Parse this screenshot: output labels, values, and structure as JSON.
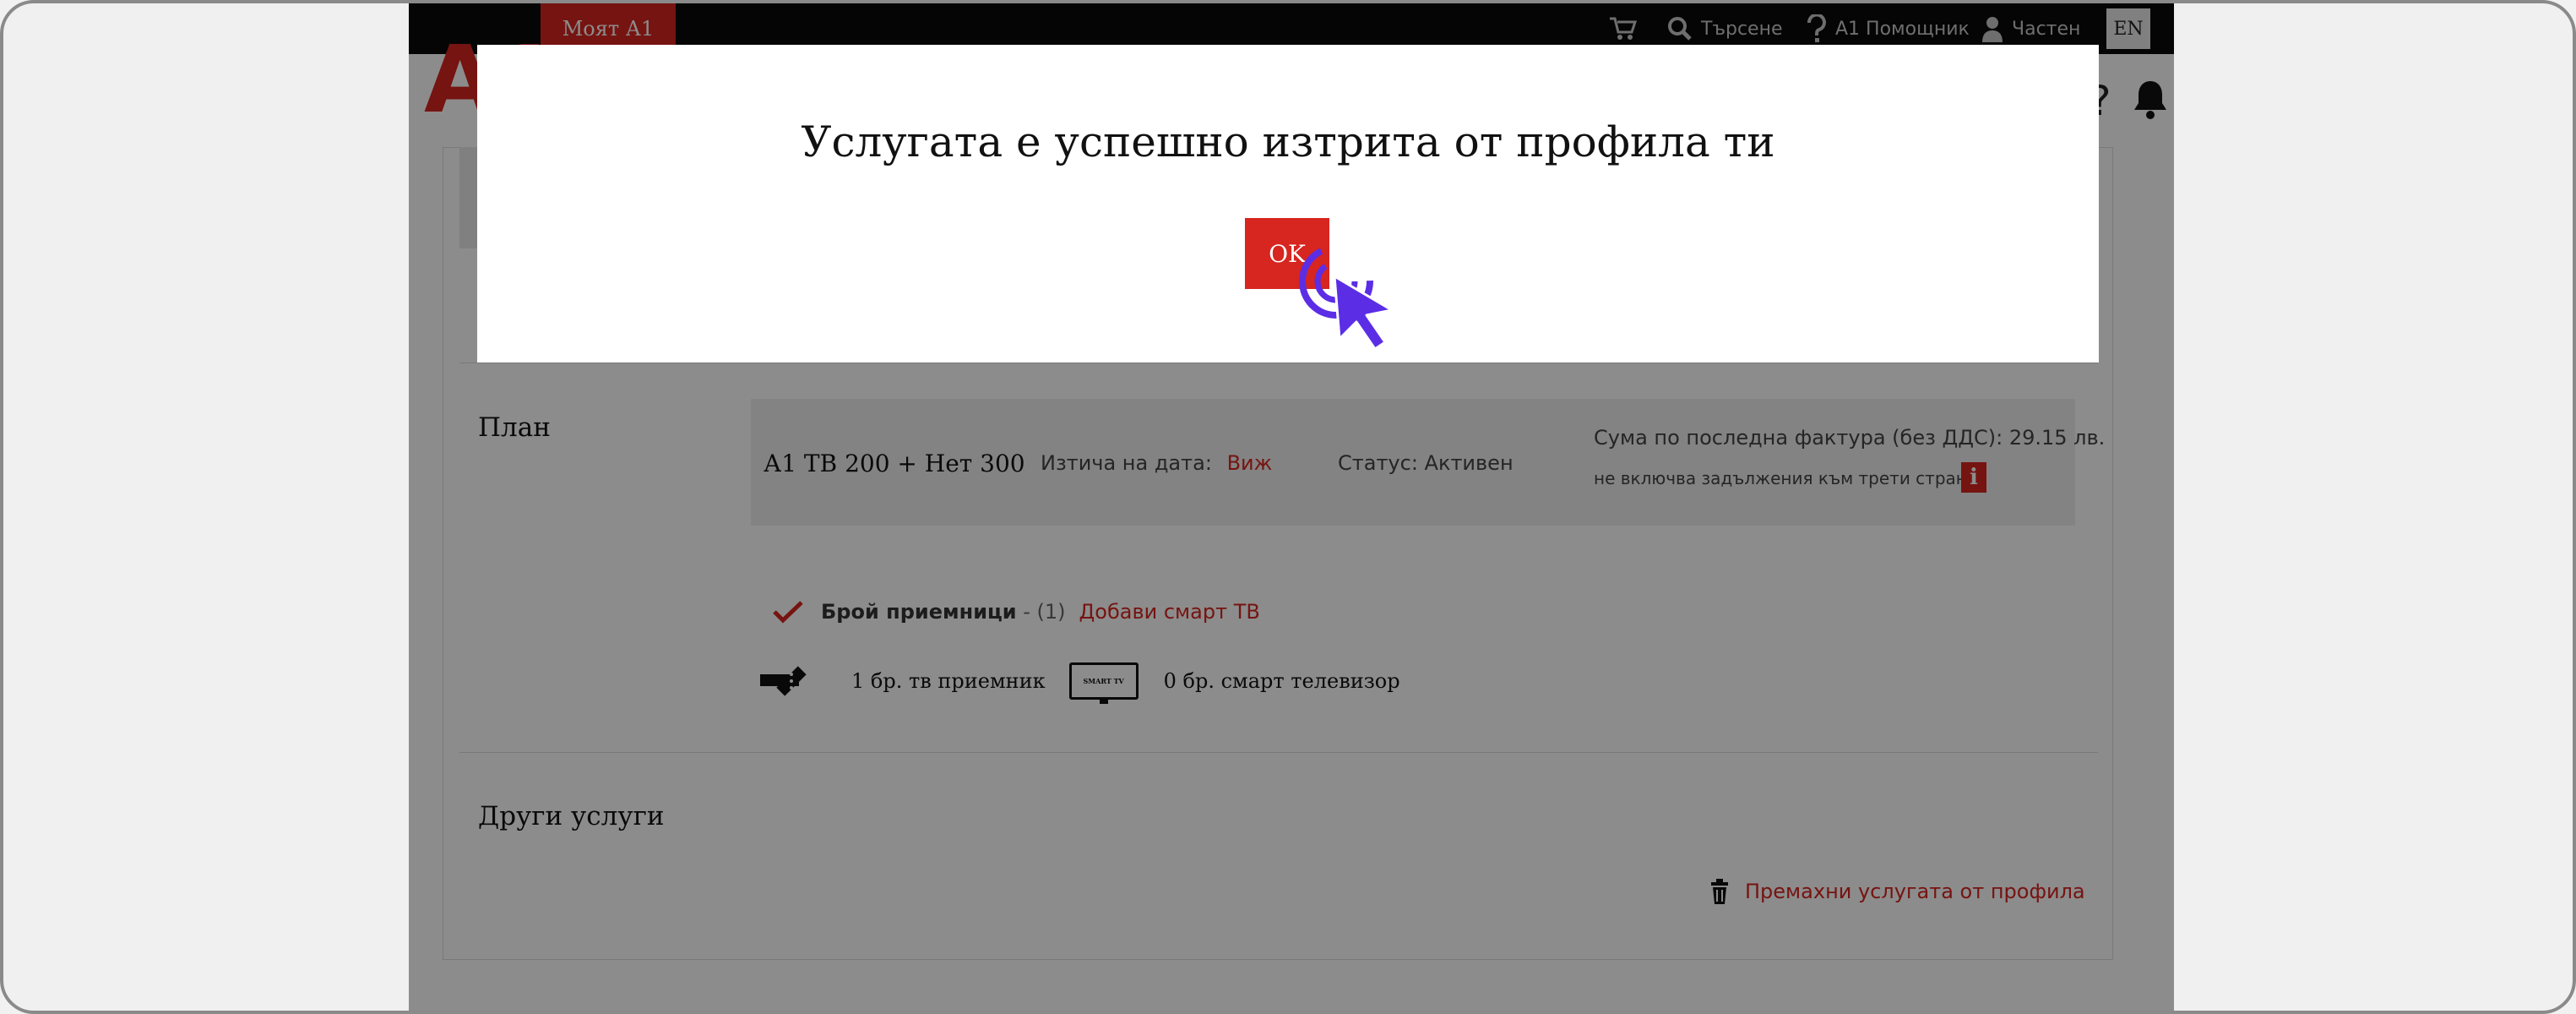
{
  "header": {
    "my_a1_tab": "Моят А1",
    "search_label": "Търсене",
    "assistant_label": "А1 Помощник",
    "account_label": "Частен",
    "language": "EN",
    "logo_text": "A1"
  },
  "plan_section": {
    "title": "План",
    "plan_name": "А1 ТВ 200 + Нет 300",
    "expiry_label": "Изтича на дата:",
    "expiry_link": "Виж",
    "status_text": "Статус: Активен",
    "invoice_text": "Сума по последна фактура (без ДДС): 29.15 лв.",
    "invoice_note": "не включва задължения към трети страни",
    "info_icon_label": "i"
  },
  "receivers": {
    "label": "Брой приемници",
    "count": " - (1)",
    "add_link": "Добави смарт ТВ",
    "tv_receiver": "1 бр. тв приемник",
    "smart_tv_badge": "SMART TV",
    "smart_tv": "0 бр. смарт телевизор"
  },
  "other_services": {
    "title": "Други услуги",
    "remove_link": "Премахни услугата от профила"
  },
  "modal": {
    "message": "Услугата е успешно изтрита от профила ти",
    "ok_label": "OK"
  },
  "colors": {
    "brand_red": "#d7251f",
    "cursor": "#5b2ee6",
    "overlay": "rgba(0,0,0,0.45)"
  },
  "icons": [
    "cart-icon",
    "search-icon",
    "question-icon",
    "user-icon",
    "bell-icon",
    "monitor-icon",
    "checkmark-icon",
    "tv-receiver-icon",
    "smart-tv-icon",
    "trash-icon",
    "info-icon",
    "pointer-cursor-icon"
  ]
}
